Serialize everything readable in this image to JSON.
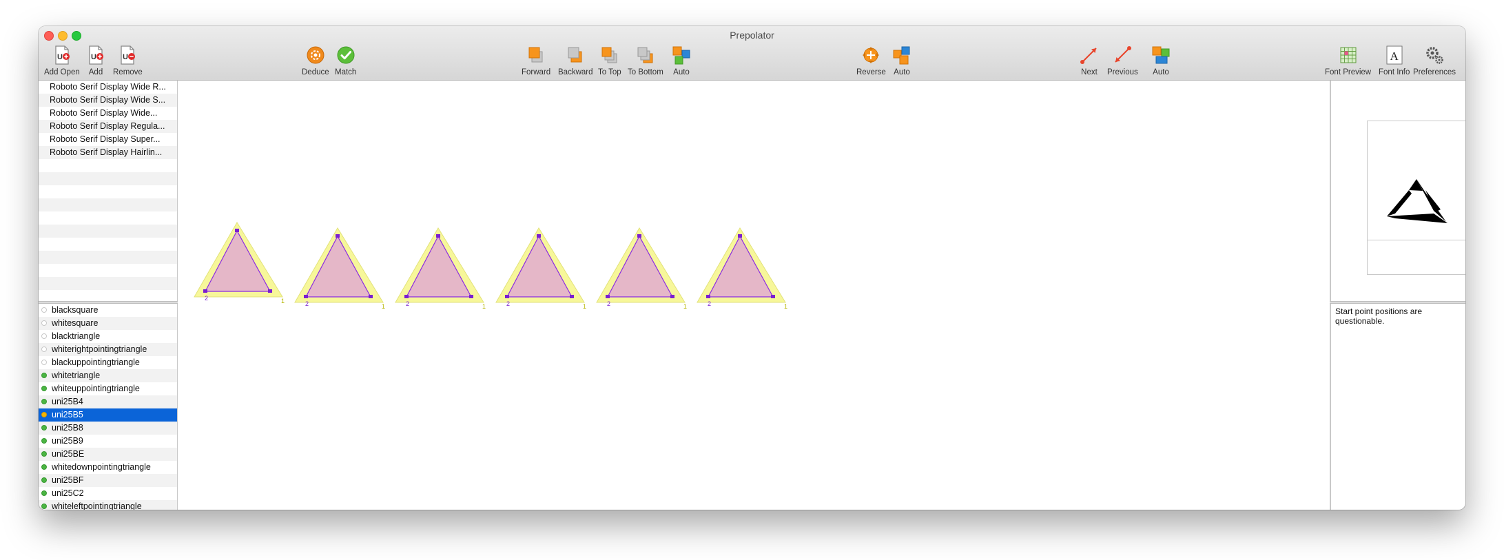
{
  "window": {
    "title": "Prepolator"
  },
  "toolbar": {
    "add_open": "Add Open",
    "add": "Add",
    "remove": "Remove",
    "deduce": "Deduce",
    "match": "Match",
    "forward": "Forward",
    "backward": "Backward",
    "to_top": "To Top",
    "to_bottom": "To Bottom",
    "auto_order": "Auto",
    "reverse": "Reverse",
    "auto_direction": "Auto",
    "next": "Next",
    "previous": "Previous",
    "auto_start": "Auto",
    "font_preview": "Font Preview",
    "font_info": "Font Info",
    "preferences": "Preferences"
  },
  "fonts": [
    "Roboto Serif Display Wide R...",
    "Roboto Serif Display Wide S...",
    "Roboto Serif Display Wide...",
    "Roboto Serif Display Regula...",
    "Roboto Serif Display Super...",
    "Roboto Serif Display Hairlin..."
  ],
  "glyphs": [
    {
      "name": "blacksquare",
      "status": "empty"
    },
    {
      "name": "whitesquare",
      "status": "empty"
    },
    {
      "name": "blacktriangle",
      "status": "empty"
    },
    {
      "name": "whiterightpointingtriangle",
      "status": "empty"
    },
    {
      "name": "blackuppointingtriangle",
      "status": "empty"
    },
    {
      "name": "whitetriangle",
      "status": "green"
    },
    {
      "name": "whiteuppointingtriangle",
      "status": "green"
    },
    {
      "name": "uni25B4",
      "status": "green"
    },
    {
      "name": "uni25B5",
      "status": "yellow",
      "selected": true
    },
    {
      "name": "uni25B8",
      "status": "green"
    },
    {
      "name": "uni25B9",
      "status": "green"
    },
    {
      "name": "uni25BE",
      "status": "green"
    },
    {
      "name": "whitedownpointingtriangle",
      "status": "green"
    },
    {
      "name": "uni25BF",
      "status": "green"
    },
    {
      "name": "uni25C2",
      "status": "green"
    },
    {
      "name": "whiteleftpointingtriangle",
      "status": "green"
    }
  ],
  "canvas": {
    "glyph_masters": [
      {
        "start_label": "2",
        "end_label": "1"
      },
      {
        "start_label": "2",
        "end_label": "1"
      },
      {
        "start_label": "2",
        "end_label": "1"
      },
      {
        "start_label": "2",
        "end_label": "1"
      },
      {
        "start_label": "2",
        "end_label": "1"
      },
      {
        "start_label": "2",
        "end_label": "1"
      }
    ]
  },
  "colors": {
    "selection": "#0b64d8",
    "outline_fill": "#e5b7c8",
    "outline_stroke": "#8a2be2",
    "halo": "#f7f79a",
    "status_ok": "#4bb543",
    "status_warn": "#f4b400"
  },
  "status": {
    "message": "Start point positions are questionable."
  }
}
